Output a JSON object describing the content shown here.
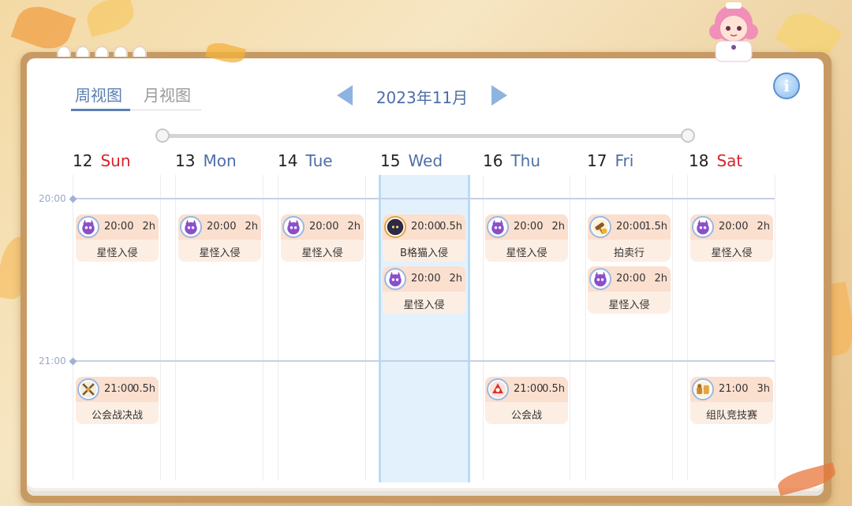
{
  "tabs": {
    "week": "周视图",
    "month": "月视图"
  },
  "month_title": "2023年11月",
  "days": [
    {
      "num": "12",
      "name": "Sun",
      "color": "red"
    },
    {
      "num": "13",
      "name": "Mon",
      "color": "blue"
    },
    {
      "num": "14",
      "name": "Tue",
      "color": "blue"
    },
    {
      "num": "15",
      "name": "Wed",
      "color": "blue"
    },
    {
      "num": "16",
      "name": "Thu",
      "color": "blue"
    },
    {
      "num": "17",
      "name": "Fri",
      "color": "blue"
    },
    {
      "num": "18",
      "name": "Sat",
      "color": "red"
    }
  ],
  "time_slots": [
    "20:00",
    "21:00"
  ],
  "events": [
    {
      "time": "20:00",
      "duration": "2h",
      "name": "星怪入侵",
      "icon": "purple-monster-icon"
    },
    {
      "time": "20:00",
      "duration": "2h",
      "name": "星怪入侵",
      "icon": "purple-monster-icon"
    },
    {
      "time": "20:00",
      "duration": "2h",
      "name": "星怪入侵",
      "icon": "purple-monster-icon"
    },
    {
      "time": "20:00",
      "duration": "0.5h",
      "name": "B格猫入侵",
      "icon": "cat-icon"
    },
    {
      "time": "20:00",
      "duration": "2h",
      "name": "星怪入侵",
      "icon": "purple-monster-icon"
    },
    {
      "time": "20:00",
      "duration": "2h",
      "name": "星怪入侵",
      "icon": "purple-monster-icon"
    },
    {
      "time": "20:00",
      "duration": "1.5h",
      "name": "拍卖行",
      "icon": "auction-icon"
    },
    {
      "time": "20:00",
      "duration": "2h",
      "name": "星怪入侵",
      "icon": "purple-monster-icon"
    },
    {
      "time": "20:00",
      "duration": "2h",
      "name": "星怪入侵",
      "icon": "purple-monster-icon"
    },
    {
      "time": "21:00",
      "duration": "0.5h",
      "name": "公会战决战",
      "icon": "crossed-swords-icon"
    },
    {
      "time": "21:00",
      "duration": "0.5h",
      "name": "公会战",
      "icon": "guild-battle-icon"
    },
    {
      "time": "21:00",
      "duration": "3h",
      "name": "组队竞技赛",
      "icon": "team-arena-icon"
    }
  ],
  "colors": {
    "accent": "#5b7fb4",
    "today_bg": "#e3f1fd",
    "card_top": "#fbdfcf",
    "card_bottom": "#fdeee3",
    "weekend": "#d8222a"
  }
}
